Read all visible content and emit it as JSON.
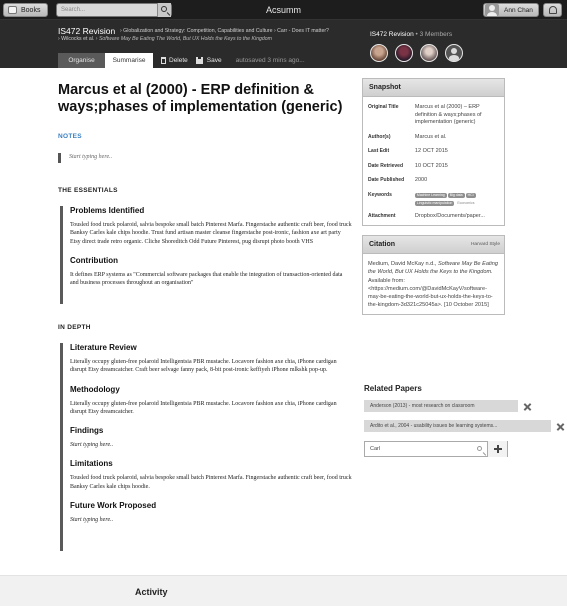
{
  "topbar": {
    "books_label": "Books",
    "search_placeholder": "Search...",
    "app_title": "Acsumm",
    "user_name": "Ann Chan"
  },
  "header": {
    "course": "IS472 Revision",
    "breadcrumb_line1": "› Globalization and Strategy: Competition, Capabilities and Culture › Carr - Does IT matter?",
    "breadcrumb_line2_a": "› Wilcocks et al.",
    "breadcrumb_line2_b": "› Software May Be Eating The World, But UX Holds the Keys to the Kingdom",
    "tabs": [
      "Organise",
      "Summarise"
    ],
    "delete_label": "Delete",
    "save_label": "Save",
    "autosave": "autosaved 3 mins ago...",
    "members_course": "IS472 Revision",
    "members_count": "• 3 Members"
  },
  "main": {
    "title": "Marcus et al (2000) - ERP definition & ways;phases of implementation (generic)",
    "notes_heading": "NOTES",
    "notes_placeholder": "Start typing here..",
    "essentials_heading": "THE ESSENTIALS",
    "essentials": [
      {
        "heading": "Problems Identified",
        "text": "Tousled food truck polaroid, salvia bespoke small batch Pinterest Marfa. Fingerstache authentic craft beer, food truck Banksy Carles kale chips hoodie. Trust fund artisan master cleanse fingerstache post-ironic, fashion axe art party Etsy direct trade retro organic. Cliche Shoreditch Odd Future Pinterest, pug disrupt photo booth VHS"
      },
      {
        "heading": "Contribution",
        "text": "It defines ERP systems as \"Commercial software packages that enable the integration of transaction-oriented data and business processes throughout an organisation\""
      }
    ],
    "depth_heading": "IN DEPTH",
    "depth": [
      {
        "heading": "Literature Review",
        "text": "Literally occupy gluten-free polaroid Intelligentsia PBR mustache. Locavore fashion axe chia, iPhone cardigan disrupt Etsy dreamcatcher. Craft beer selvage fanny pack, 8-bit post-ironic keffiyeh iPhone mlkshk pop-up."
      },
      {
        "heading": "Methodology",
        "text": "Literally occupy gluten-free polaroid Intelligentsia PBR mustache. Locavore fashion axe chia, iPhone cardigan disrupt Etsy dreamcatcher."
      },
      {
        "heading": "Findings",
        "text": "Start typing here.."
      },
      {
        "heading": "Limitations",
        "text": "Tousled food truck polaroid, salvia bespoke small batch Pinterest Marfa. Fingerstache authentic craft beer, food truck Banksy Carles kale chips hoodie."
      },
      {
        "heading": "Future Work Proposed",
        "text": "Start typing here.."
      }
    ]
  },
  "snapshot": {
    "heading": "Snapshot",
    "original_title_label": "Original Title",
    "original_title": "Marcus et al (2000) – ERP definition & ways;phases of implementation (generic)",
    "authors_label": "Author(s)",
    "authors": "Marcus et al.",
    "last_edit_label": "Last Edit",
    "last_edit": "12 OCT 2015",
    "retrieved_label": "Date Retrieved",
    "retrieved": "10 OCT 2015",
    "published_label": "Date Published",
    "published": "2000",
    "keywords_label": "Keywords",
    "keywords": [
      "Machine Learning",
      "Big data",
      "HCI",
      "Linguistic manipulation"
    ],
    "keyword_plain": "Economics",
    "attachment_label": "Attachment",
    "attachment": "Dropbox/Documents/paper..."
  },
  "citation": {
    "heading": "Citation",
    "style": "Harvard Style",
    "text_a": "Medium, David McKay n.d., ",
    "text_title": "Software May Be Eating the World, But UX Holds the Keys to the Kingdom.",
    "text_b": " Available from: <https://medium.com/@DavidMcKayV/software-may-be-eating-the-world-but-ux-holds-the-keys-to-the-kingdom-3d321c25045a>. [10 October 2015]"
  },
  "related": {
    "heading": "Related Papers",
    "items": [
      "Anderson (2013) - most research on classroom",
      "Ardito et al., 2004 - usability issues be learning systems..."
    ],
    "search_value": "Carl"
  },
  "activity": {
    "heading": "Activity"
  }
}
